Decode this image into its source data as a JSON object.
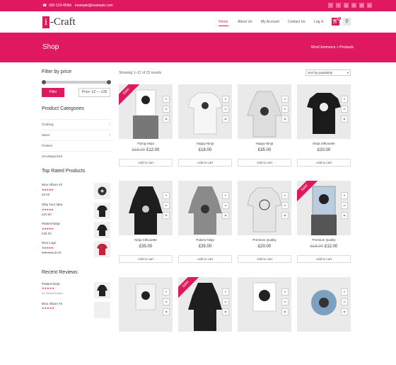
{
  "topbar": {
    "phone": "000-123-456",
    "email": "example@example.com",
    "social_icons": [
      "facebook-icon",
      "twitter-icon",
      "google-plus-icon",
      "linkedin-icon",
      "instagram-icon",
      "pinterest-icon"
    ]
  },
  "logo": {
    "letter": "i",
    "rest": "-Craft"
  },
  "nav": {
    "items": [
      "Home",
      "About Us",
      "My Account",
      "Contact Us",
      "Log in"
    ],
    "active": "Home",
    "cart_count": "0"
  },
  "banner": {
    "title": "Shop",
    "breadcrumb": "WooCommerce > Products"
  },
  "filter": {
    "heading": "Filter by price",
    "button": "Filter",
    "range_label": "Price: £2 — £35"
  },
  "categories": {
    "heading": "Product Categories",
    "items": [
      {
        "label": "Clothing",
        "arrow": "›"
      },
      {
        "label": "Music",
        "arrow": "›"
      },
      {
        "label": "Posters",
        "arrow": ""
      },
      {
        "label": "Uncategorized",
        "arrow": ""
      }
    ]
  },
  "top_rated": {
    "heading": "Top Rated Products",
    "items": [
      {
        "name": "Woo Album #4",
        "stars": "★★★★★",
        "price": "£9.00",
        "old_price": ""
      },
      {
        "name": "Ship Your Idea",
        "stars": "★★★★★",
        "price": "£20.00",
        "old_price": ""
      },
      {
        "name": "Patient Ninja",
        "stars": "★★★★★",
        "price": "£35.00",
        "old_price": ""
      },
      {
        "name": "Woo Logo",
        "stars": "★★★★★",
        "price": "£18.00",
        "old_price": "£20.00"
      }
    ]
  },
  "recent_reviews": {
    "heading": "Recent Reviews",
    "items": [
      {
        "name": "Patient Ninja",
        "stars": "★★★★★",
        "by": "by James Koster"
      },
      {
        "name": "Woo Album #4",
        "stars": "★★★★★",
        "by": ""
      }
    ]
  },
  "results": {
    "showing": "Showing 1–12 of 23 results",
    "sort": "Sort by popularity"
  },
  "products": [
    {
      "name": "Flying Ninja",
      "old_price": "£15.00",
      "price": "£12.00",
      "sale": true,
      "button": "Add to cart"
    },
    {
      "name": "Happy Ninja",
      "old_price": "",
      "price": "£18.00",
      "sale": false,
      "button": "Add to cart"
    },
    {
      "name": "Happy Ninja",
      "old_price": "",
      "price": "£35.00",
      "sale": false,
      "button": "Add to cart"
    },
    {
      "name": "Ninja Silhouette",
      "old_price": "",
      "price": "£20.00",
      "sale": false,
      "button": "Add to cart"
    },
    {
      "name": "Ninja Silhouette",
      "old_price": "",
      "price": "£35.00",
      "sale": false,
      "button": "Add to cart"
    },
    {
      "name": "Patient Ninja",
      "old_price": "",
      "price": "£35.00",
      "sale": false,
      "button": "Add to cart"
    },
    {
      "name": "Premium Quality",
      "old_price": "",
      "price": "£20.00",
      "sale": false,
      "button": "Add to cart"
    },
    {
      "name": "Premium Quality",
      "old_price": "£15.00",
      "price": "£12.00",
      "sale": true,
      "button": "Add to cart"
    },
    {
      "name": "",
      "old_price": "",
      "price": "",
      "sale": false,
      "button": ""
    },
    {
      "name": "",
      "old_price": "",
      "price": "",
      "sale": true,
      "button": ""
    },
    {
      "name": "",
      "old_price": "",
      "price": "",
      "sale": false,
      "button": ""
    },
    {
      "name": "",
      "old_price": "",
      "price": "",
      "sale": false,
      "button": ""
    }
  ],
  "sale_label": "Sale!",
  "action_icons": [
    "heart-icon",
    "compare-icon",
    "quick-view-icon"
  ],
  "colors": {
    "accent": "#e0195f"
  }
}
